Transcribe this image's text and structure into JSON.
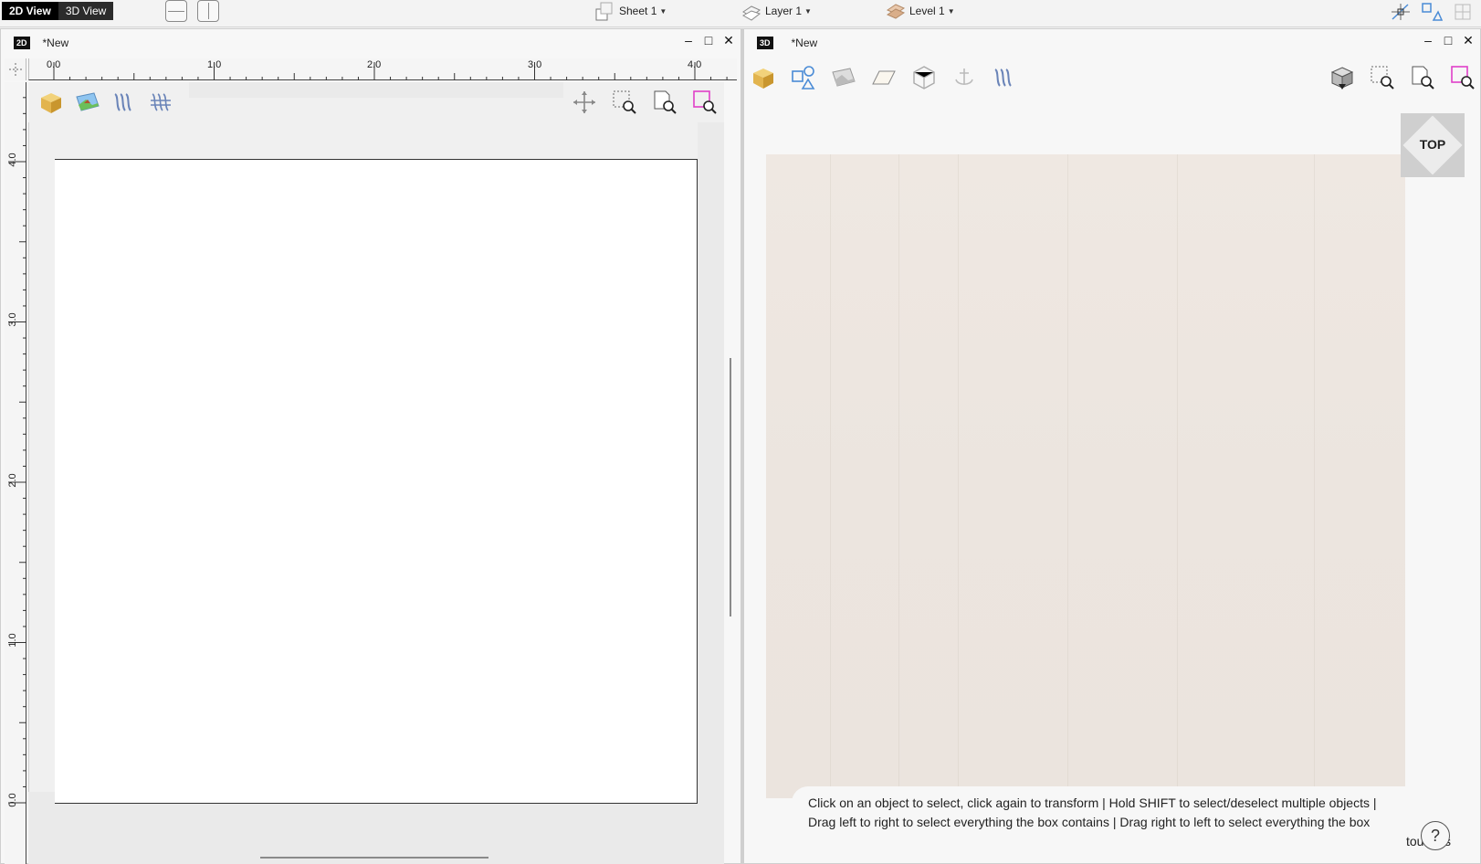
{
  "topbar": {
    "view_2d_label": "2D View",
    "view_3d_label": "3D View",
    "sheet_label": "Sheet 1",
    "layer_label": "Layer 1",
    "level_label": "Level 1"
  },
  "panel2d": {
    "badge": "2D",
    "title": "*New",
    "minimize": "–",
    "maximize": "□",
    "close": "✕",
    "ruler_h": [
      "0.0",
      "1.0",
      "2.0",
      "3.0",
      "4.0"
    ],
    "ruler_v": [
      "4.0",
      "3.0",
      "2.0",
      "1.0",
      "0.0"
    ]
  },
  "panel3d": {
    "badge": "3D",
    "title": "*New",
    "minimize": "–",
    "maximize": "□",
    "close": "✕",
    "navcube_label": "TOP",
    "hint_line1": "Click on an object to select, click again to transform | Hold SHIFT to select/deselect multiple objects |",
    "hint_line2": "Drag left to right to select everything the box contains | Drag right to left to select everything the box",
    "hint_line3": "touches",
    "help_label": "?"
  },
  "colors": {
    "accent_magenta": "#e040c8",
    "icon_blue": "#4a8bd6",
    "cube_gold": "#e2b44e",
    "ground": "#ede6e0"
  }
}
